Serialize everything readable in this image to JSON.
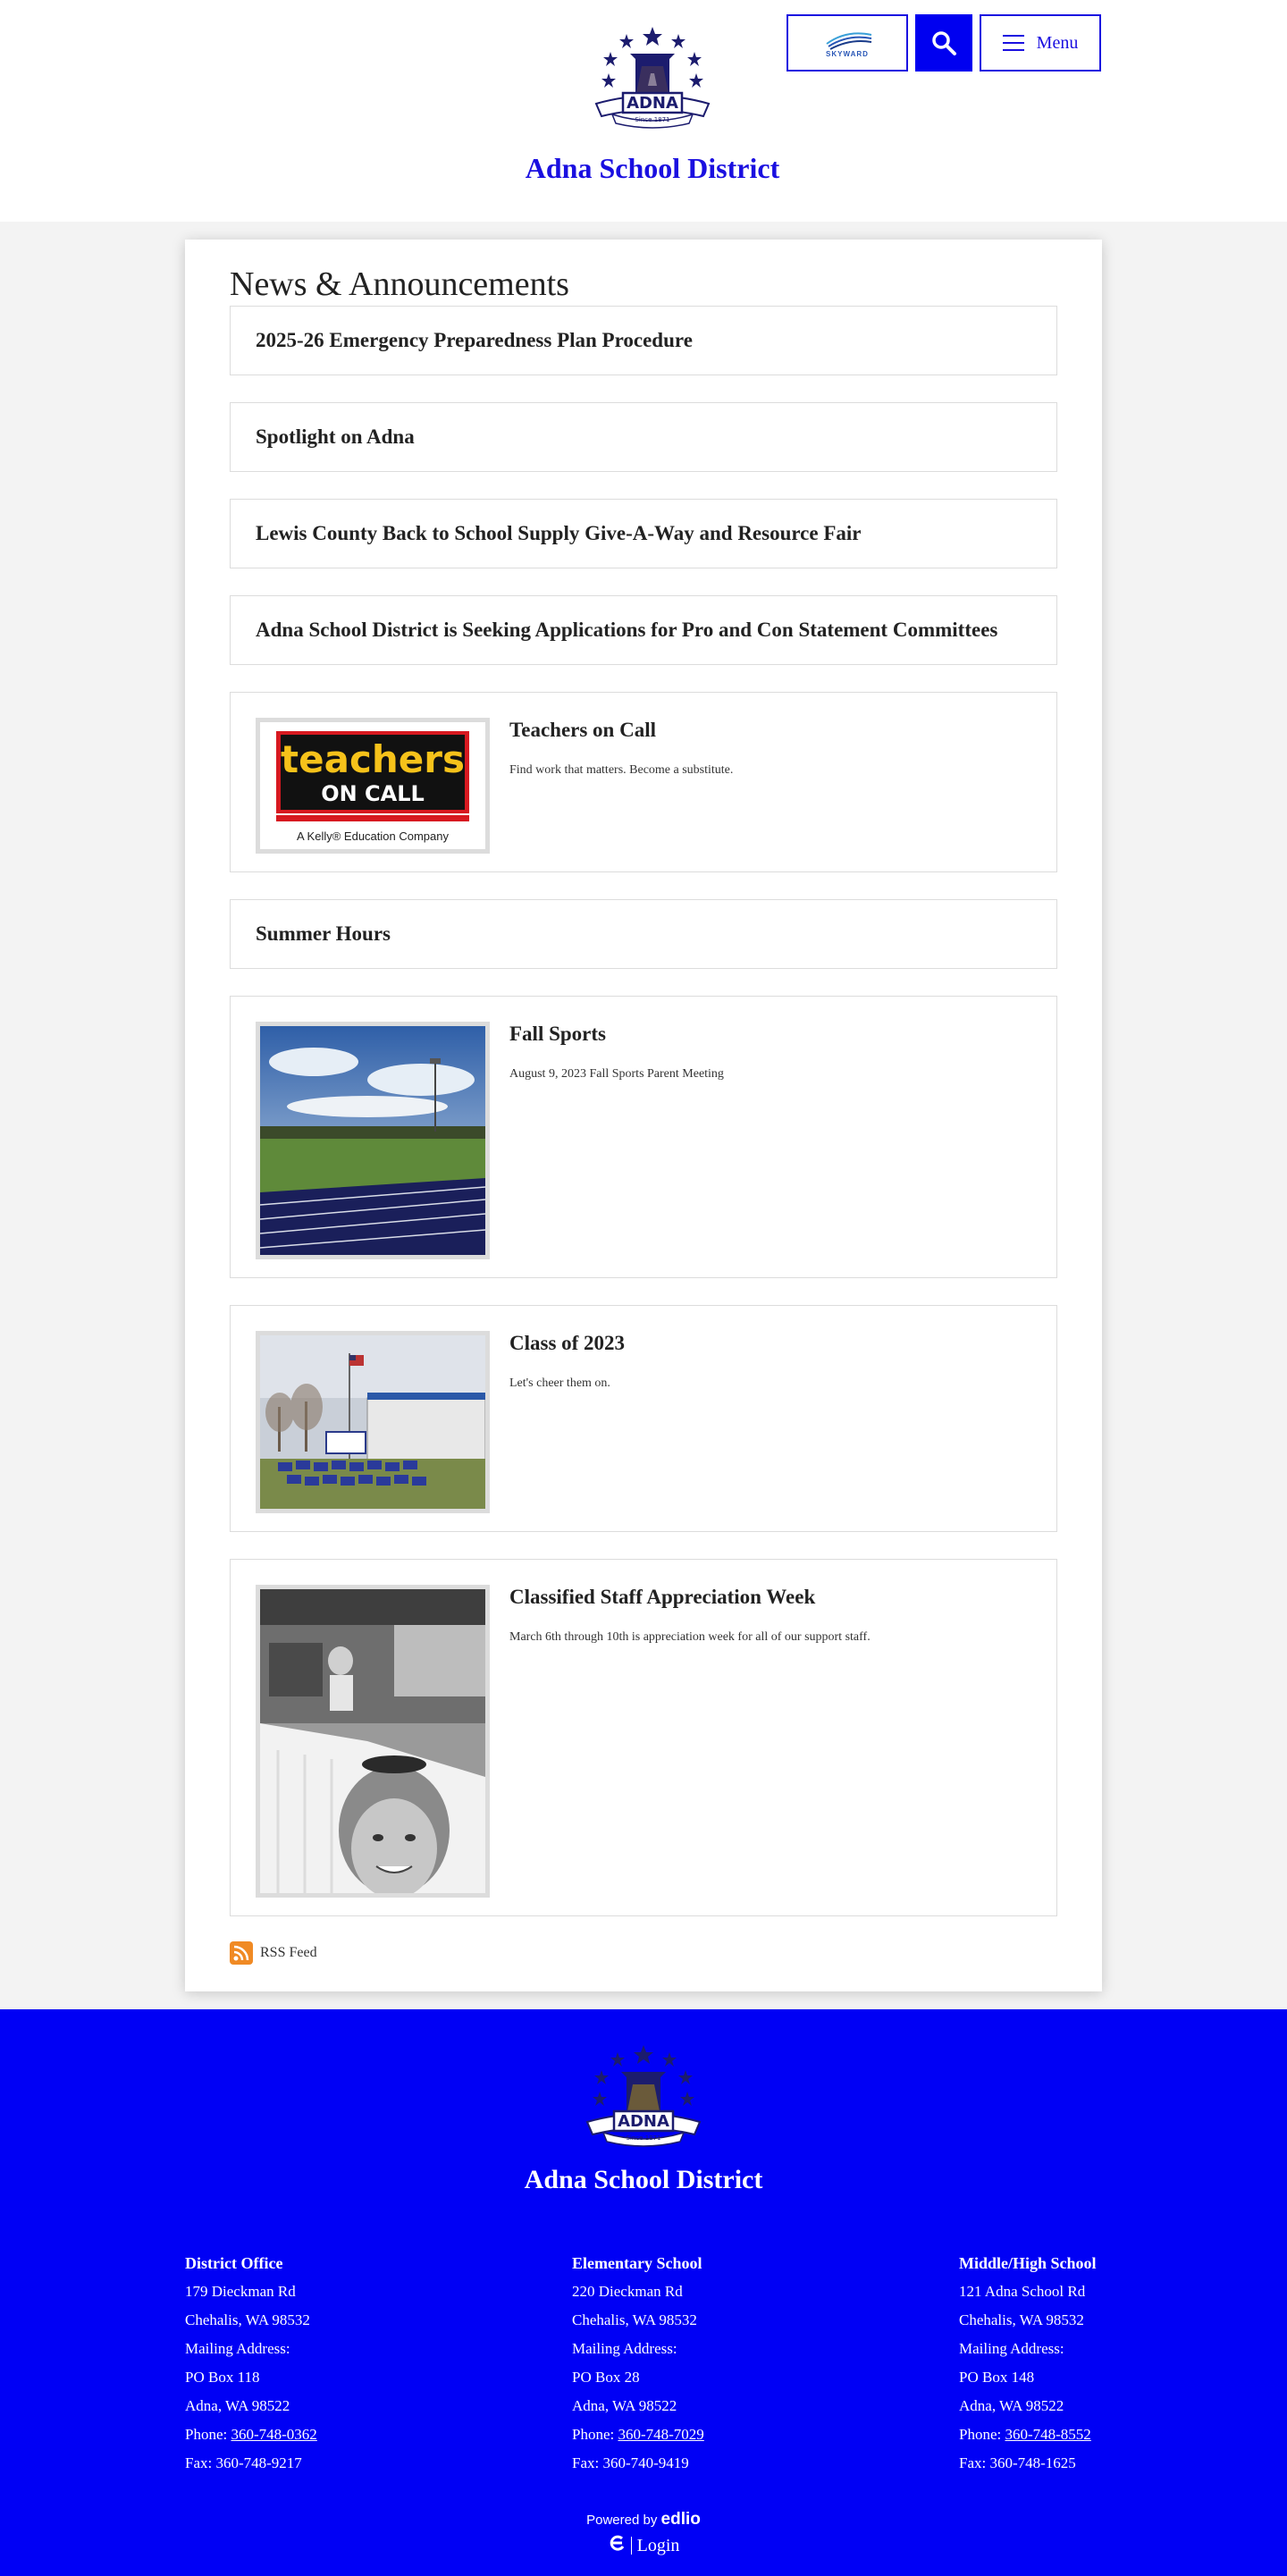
{
  "header": {
    "site_name": "Adna School District",
    "logo_text": "ADNA",
    "logo_since": "Since 1871",
    "skyward_label": "SKYWARD",
    "menu_label": "Menu"
  },
  "main": {
    "title": "News & Announcements",
    "items": [
      {
        "title": "2025-26 Emergency Preparedness Plan Procedure"
      },
      {
        "title": "Spotlight on Adna"
      },
      {
        "title": "Lewis County Back to School Supply Give-A-Way and Resource Fair"
      },
      {
        "title": "Adna School District is Seeking Applications for Pro and Con Statement Committees"
      },
      {
        "title": "Teachers on Call",
        "desc": "Find work that matters. Become a substitute.",
        "img_text_1": "teachers",
        "img_text_2": "ON CALL",
        "img_text_3": "A Kelly® Education Company"
      },
      {
        "title": "Summer Hours"
      },
      {
        "title": "Fall Sports",
        "desc": "August 9, 2023 Fall Sports Parent Meeting"
      },
      {
        "title": "Class of 2023",
        "desc": "Let's cheer them on."
      },
      {
        "title": "Classified Staff Appreciation Week",
        "desc": "March 6th through 10th is appreciation week for all of our support staff."
      }
    ],
    "rss_label": "RSS Feed"
  },
  "footer": {
    "site_name": "Adna School District",
    "columns": [
      {
        "heading": "District Office",
        "line1": "179 Dieckman Rd",
        "line2": "Chehalis, WA 98532",
        "line3": "Mailing Address:",
        "line4": "PO Box 118",
        "line5": "Adna, WA 98522",
        "phone_label": "Phone: ",
        "phone": "360-748-0362",
        "fax": "Fax: 360-748-9217"
      },
      {
        "heading": "Elementary School",
        "line1": "220 Dieckman Rd",
        "line2": "Chehalis, WA 98532",
        "line3": "Mailing Address:",
        "line4": "PO Box 28",
        "line5": "Adna, WA 98522",
        "phone_label": "Phone: ",
        "phone": "360-748-7029",
        "fax": "Fax: 360-740-9419"
      },
      {
        "heading": "Middle/High School",
        "line1": "121 Adna School Rd",
        "line2": "Chehalis, WA 98532",
        "line3": "Mailing Address:",
        "line4": "PO Box 148",
        "line5": "Adna, WA 98522",
        "phone_label": "Phone: ",
        "phone": "360-748-8552",
        "fax": "Fax: 360-748-1625"
      }
    ],
    "powered_by": "Powered by",
    "edlio": "edlio",
    "login": "Login"
  },
  "colors": {
    "brand_blue": "#0000f5",
    "link_blue": "#1a0fe0",
    "rss_orange": "#f08a24"
  }
}
